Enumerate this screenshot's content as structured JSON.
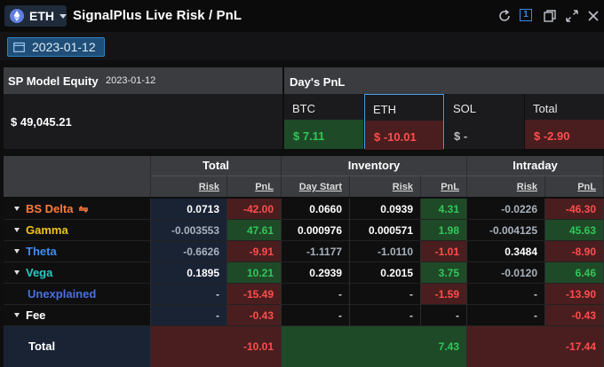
{
  "header": {
    "asset": "ETH",
    "title": "SignalPlus Live Risk / PnL",
    "window_number": "1",
    "date_chip": "2023-01-12"
  },
  "summary": {
    "equity_label": "SP Model Equity",
    "equity_date": "2023-01-12",
    "equity_value": "$ 49,045.21",
    "days_pnl_label": "Day's PnL",
    "cards": [
      {
        "label": "BTC",
        "value": "$ 7.11",
        "tone": "pos"
      },
      {
        "label": "ETH",
        "value": "$ -10.01",
        "tone": "neg"
      },
      {
        "label": "SOL",
        "value": "$ -",
        "tone": "none"
      },
      {
        "label": "Total",
        "value": "$ -2.90",
        "tone": "neg"
      }
    ]
  },
  "table": {
    "groups": [
      "Total",
      "Inventory",
      "Intraday"
    ],
    "subcols": [
      "Risk",
      "PnL",
      "Day Start",
      "Risk",
      "PnL",
      "Risk",
      "PnL"
    ],
    "rows": [
      {
        "label": "BS Delta",
        "icon": "swap-icon",
        "color": "#ff7a3d",
        "cells": [
          "0.0713",
          "-42.00",
          "0.0660",
          "0.0939",
          "4.31",
          "-0.0226",
          "-46.30"
        ]
      },
      {
        "label": "Gamma",
        "color": "#f0c419",
        "cells": [
          "-0.003553",
          "47.61",
          "0.000976",
          "0.000571",
          "1.98",
          "-0.004125",
          "45.63"
        ]
      },
      {
        "label": "Theta",
        "color": "#3f8df0",
        "cells": [
          "-0.6626",
          "-9.91",
          "-1.1177",
          "-1.0110",
          "-1.01",
          "0.3484",
          "-8.90"
        ]
      },
      {
        "label": "Vega",
        "color": "#27c9c0",
        "cells": [
          "0.1895",
          "10.21",
          "0.2939",
          "0.2015",
          "3.75",
          "-0.0120",
          "6.46"
        ]
      },
      {
        "label": "Unexplained",
        "color": "#4a6fe0",
        "cells": [
          "-",
          "-15.49",
          "-",
          "-",
          "-1.59",
          "-",
          "-13.90"
        ]
      },
      {
        "label": "Fee",
        "color": "#ffffff",
        "cells": [
          "-",
          "-0.43",
          "-",
          "-",
          "-",
          "-",
          "-0.43"
        ]
      }
    ],
    "total_label": "Total",
    "totals": [
      "-10.01",
      "7.43",
      "-17.44"
    ]
  },
  "colors": {
    "pos": "#31c75a",
    "neg": "#ff4d4d",
    "pos_bg": "#1f4a28",
    "neg_bg": "#4a1e1f",
    "accent": "#2f7fc0"
  }
}
